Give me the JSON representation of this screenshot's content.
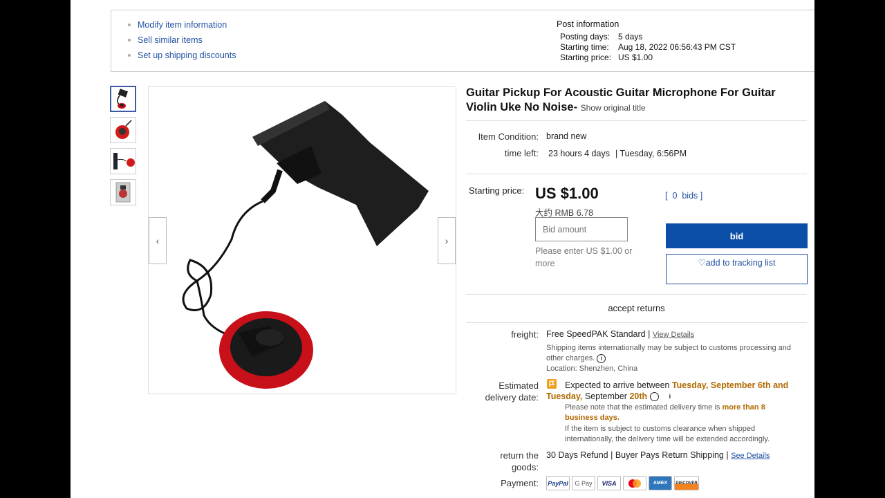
{
  "actions": [
    "Modify item information",
    "Sell similar items",
    "Set up shipping discounts"
  ],
  "post": {
    "title": "Post information",
    "rows": [
      {
        "k": "Posting days:",
        "v": "5 days"
      },
      {
        "k": "Starting time:",
        "v": "Aug 18, 2022 06:56:43 PM CST"
      },
      {
        "k": "Starting price:",
        "v": "US $1.00"
      }
    ]
  },
  "item": {
    "title": "Guitar Pickup For Acoustic Guitar Microphone For Guitar Violin Uke No  Noise-",
    "show_original": "Show original title",
    "condition_label": "Item Condition:",
    "condition": "brand new",
    "timeleft_label": "time left:",
    "timeleft": "23 hours 4 days",
    "timeleft_end": "| Tuesday, 6:56PM"
  },
  "bidding": {
    "starting_label": "Starting price:",
    "price": "US $1.00",
    "rmb": "大约 RMB 6.78",
    "bids_open": "[",
    "bids_count": "0",
    "bids_word": "bids",
    "bids_close": "]",
    "bid_placeholder": "Bid amount",
    "hint": "Please enter US $1.00 or more",
    "bid_button": "bid",
    "track_button": "add to tracking list"
  },
  "accept_returns": "accept returns",
  "freight": {
    "label": "freight:",
    "free": "Free",
    "method": "SpeedPAK Standard |",
    "view_details": "View Details",
    "note": "Shipping items internationally may be subject to customs processing and other charges.",
    "location": "Location: Shenzhen, China"
  },
  "delivery": {
    "label1": "Estimated",
    "label2": "delivery date:",
    "expected": "Expected to arrive between",
    "date1": "Tuesday, September 6th and Tuesday,",
    "date2": "September",
    "date3": "20th",
    "note1a": "Please note that the estimated delivery time is",
    "note1b": "more than 8 business days.",
    "note2": "If the item is subject to customs clearance when shipped internationally, the delivery time will be extended accordingly."
  },
  "returns": {
    "label1": "return the",
    "label2": "goods:",
    "text": "30 Days Refund | Buyer Pays Return Shipping |",
    "see_details": "See Details"
  },
  "payment": {
    "label": "Payment:",
    "methods": [
      "PayPal",
      "G Pay",
      "VISA",
      "MC",
      "AMEX",
      "DISCOVER"
    ]
  },
  "colors": {
    "primary": "#0b4fa8",
    "link": "#2150a0",
    "accent_orange": "#b06a00",
    "pickup_red": "#c8101a"
  }
}
